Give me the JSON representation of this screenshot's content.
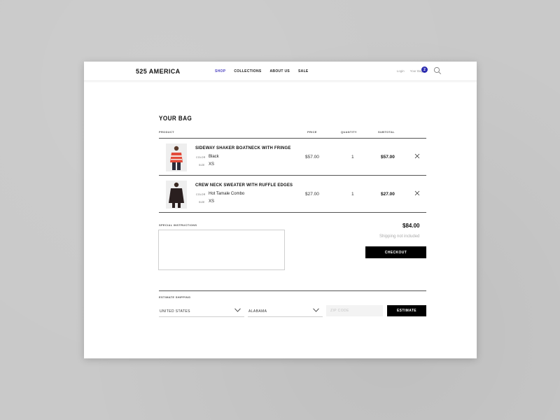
{
  "header": {
    "logo": "525 AMERICA",
    "nav": [
      "SHOP",
      "COLLECTIONS",
      "ABOUT US",
      "SALE"
    ],
    "active_nav": "SHOP",
    "login_label": "Login",
    "bag_label": "Your Bag",
    "bag_count": "2",
    "search_icon": "search-icon"
  },
  "cart": {
    "title": "YOUR BAG",
    "columns": {
      "product": "PRODUCT",
      "price": "PRICE",
      "quantity": "QUANTITY",
      "subtotal": "SUBTOTAL"
    },
    "items": [
      {
        "name": "SIDEWAY SHAKER BOATNECK WITH FRINGE",
        "color_label": "COLOR",
        "color": "Black",
        "size_label": "SIZE",
        "size": "XS",
        "price": "$57.00",
        "quantity": "1",
        "subtotal": "$57.00"
      },
      {
        "name": "CREW NECK SWEATER WITH RUFFLE EDGES",
        "color_label": "COLOR",
        "color": "Hot Tamale Combo",
        "size_label": "SIZE",
        "size": "XS",
        "price": "$27.00",
        "quantity": "1",
        "subtotal": "$27.00"
      }
    ]
  },
  "summary": {
    "special_instructions_label": "SPECIAL INSTRUCTIONS",
    "total": "$84.00",
    "shipping_note": "Shipping not included",
    "checkout_label": "CHECKOUT"
  },
  "shipping": {
    "label": "ESTIMATE SHIPPING",
    "country": "UNITED STATES",
    "state": "ALABAMA",
    "zip_placeholder": "ZIP CODE",
    "estimate_label": "ESTIMATE"
  },
  "colors": {
    "accent": "#4a3fbf",
    "badge": "#2b2bb0",
    "button": "#000000"
  }
}
